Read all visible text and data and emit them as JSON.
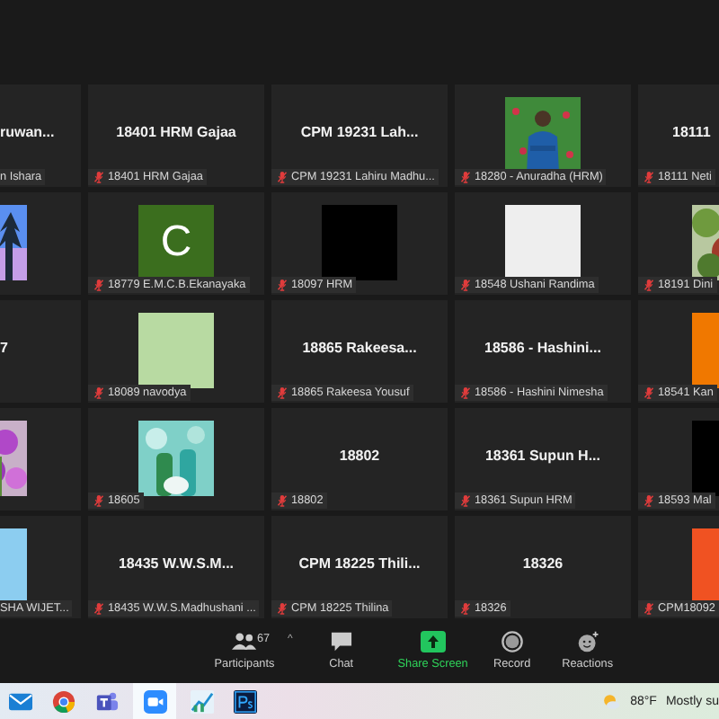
{
  "rows": [
    {
      "tiles": [
        {
          "kind": "name",
          "title": "ruwan...",
          "label": "n Ishara",
          "muted": false
        },
        {
          "kind": "name",
          "title": "18401 HRM Gajaa",
          "label": "18401 HRM Gajaa",
          "muted": true
        },
        {
          "kind": "name",
          "title": "CPM 19231  Lah...",
          "label": "CPM 19231  Lahiru Madhu...",
          "muted": true
        },
        {
          "kind": "picture",
          "label": "18280 - Anuradha (HRM)",
          "muted": true
        },
        {
          "kind": "name",
          "title": "18111",
          "label": "18111 Neti",
          "muted": true
        }
      ]
    },
    {
      "tiles": [
        {
          "kind": "picture"
        },
        {
          "kind": "avatar",
          "color": "#3b6e1e",
          "letter": "C",
          "label": "18779 E.M.C.B.Ekanayaka",
          "muted": true
        },
        {
          "kind": "avatar",
          "color": "#000000",
          "label": "18097 HRM",
          "muted": true
        },
        {
          "kind": "avatar",
          "color": "#eeeeee",
          "label": "18548 Ushani Randima",
          "muted": true
        },
        {
          "kind": "picture",
          "label": "18191 Dini",
          "muted": true
        }
      ]
    },
    {
      "tiles": [
        {
          "kind": "name",
          "title": "7"
        },
        {
          "kind": "avatar",
          "color": "#b8daa2",
          "label": "18089 navodya",
          "muted": true
        },
        {
          "kind": "name",
          "title": "18865 Rakeesa...",
          "label": "18865 Rakeesa Yousuf",
          "muted": true
        },
        {
          "kind": "name",
          "title": "18586 - Hashini...",
          "label": "18586 - Hashini Nimesha",
          "muted": true
        },
        {
          "kind": "avatar",
          "color": "#f07800",
          "label": "18541 Kan",
          "muted": true
        }
      ]
    },
    {
      "tiles": [
        {
          "kind": "picture"
        },
        {
          "kind": "picture",
          "label": "18605",
          "muted": true
        },
        {
          "kind": "name",
          "title": "18802",
          "label": "18802",
          "muted": true
        },
        {
          "kind": "name",
          "title": "18361 Supun H...",
          "label": "18361 Supun HRM",
          "muted": true
        },
        {
          "kind": "avatar",
          "color": "#000000",
          "label": "18593 Mal",
          "muted": true
        }
      ]
    },
    {
      "tiles": [
        {
          "kind": "avatar",
          "color": "#8ccdf0",
          "label": "SHA WIJET...",
          "muted": false
        },
        {
          "kind": "name",
          "title": "18435  W.W.S.M...",
          "label": "18435 W.W.S.Madhushani ...",
          "muted": true
        },
        {
          "kind": "name",
          "title": "CPM 18225  Thili...",
          "label": "CPM 18225 Thilina",
          "muted": true
        },
        {
          "kind": "name",
          "title": "18326",
          "label": "18326",
          "muted": true
        },
        {
          "kind": "avatar",
          "color": "#f05222",
          "label": "CPM18092",
          "muted": true
        }
      ]
    }
  ],
  "toolbar": {
    "participants": {
      "label": "Participants",
      "count": "67",
      "caret": "^"
    },
    "buttons": [
      {
        "kind": "chat",
        "label": "Chat"
      },
      {
        "kind": "share",
        "label": "Share Screen"
      },
      {
        "kind": "record",
        "label": "Record"
      },
      {
        "kind": "reactions",
        "label": "Reactions"
      }
    ]
  },
  "taskbar": {
    "apps": [
      {
        "kind": "mail",
        "selected": false
      },
      {
        "kind": "chrome",
        "selected": false
      },
      {
        "kind": "teams",
        "selected": false
      },
      {
        "kind": "zoom",
        "selected": true
      },
      {
        "kind": "stocks",
        "selected": false
      },
      {
        "kind": "ps",
        "selected": false
      }
    ],
    "weather": {
      "temperature": "88°F",
      "condition": "Mostly su"
    }
  }
}
